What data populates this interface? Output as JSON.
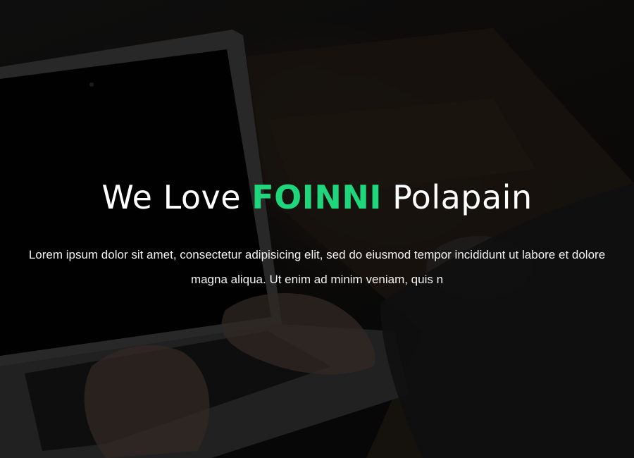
{
  "hero": {
    "title_before": "We Love",
    "title_brand": "FOINNI",
    "title_after": "Polapain",
    "lead_line1": "Lorem ipsum dolor sit amet, consectetur adipisicing elit, sed do eiusmod tempor incididunt ut labore et dolore",
    "lead_line2": "magna aliqua. Ut enim ad minim veniam, quis n"
  },
  "colors": {
    "brand_accent": "#1fd67c",
    "text": "#ffffff",
    "overlay": "#000000"
  }
}
